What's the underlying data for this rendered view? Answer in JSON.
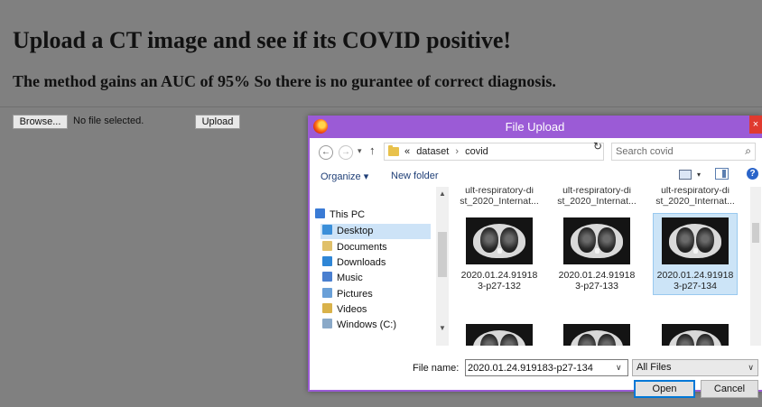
{
  "page": {
    "title": "Upload a CT image and see if its COVID positive!",
    "subtitle": "The method gains an AUC of 95% So there is no gurantee of correct diagnosis."
  },
  "form": {
    "browse_label": "Browse...",
    "no_file_text": "No file selected.",
    "upload_label": "Upload"
  },
  "dialog": {
    "title": "File Upload",
    "close_label": "×",
    "address": {
      "prefix": "«",
      "breadcrumb": [
        "dataset",
        "covid"
      ]
    },
    "search_placeholder": "Search covid",
    "toolbar": {
      "organize": "Organize ▾",
      "new_folder": "New folder"
    },
    "nav_items": [
      {
        "label": "This PC",
        "icon": "computer-icon"
      },
      {
        "label": "Desktop",
        "icon": "desktop-folder-icon",
        "selected": true
      },
      {
        "label": "Documents",
        "icon": "documents-folder-icon"
      },
      {
        "label": "Downloads",
        "icon": "downloads-folder-icon"
      },
      {
        "label": "Music",
        "icon": "music-folder-icon"
      },
      {
        "label": "Pictures",
        "icon": "pictures-folder-icon"
      },
      {
        "label": "Videos",
        "icon": "videos-folder-icon"
      },
      {
        "label": "Windows (C:)",
        "icon": "drive-icon"
      }
    ],
    "files_top_partial": [
      {
        "line1": "ult-respiratory-di",
        "line2": "st_2020_Internat..."
      },
      {
        "line1": "ult-respiratory-di",
        "line2": "st_2020_Internat..."
      },
      {
        "line1": "ult-respiratory-di",
        "line2": "st_2020_Internat..."
      }
    ],
    "files": [
      {
        "line1": "2020.01.24.91918",
        "line2": "3-p27-132",
        "selected": false
      },
      {
        "line1": "2020.01.24.91918",
        "line2": "3-p27-133",
        "selected": false
      },
      {
        "line1": "2020.01.24.91918",
        "line2": "3-p27-134",
        "selected": true
      }
    ],
    "file_name_label": "File name:",
    "file_name_value": "2020.01.24.919183-p27-134",
    "file_type": "All Files",
    "open_label": "Open",
    "cancel_label": "Cancel",
    "colors": {
      "titlebar": "#9b5bd6",
      "close": "#e03a2f",
      "selection": "#cce4f7",
      "open_border": "#0078d7"
    }
  }
}
